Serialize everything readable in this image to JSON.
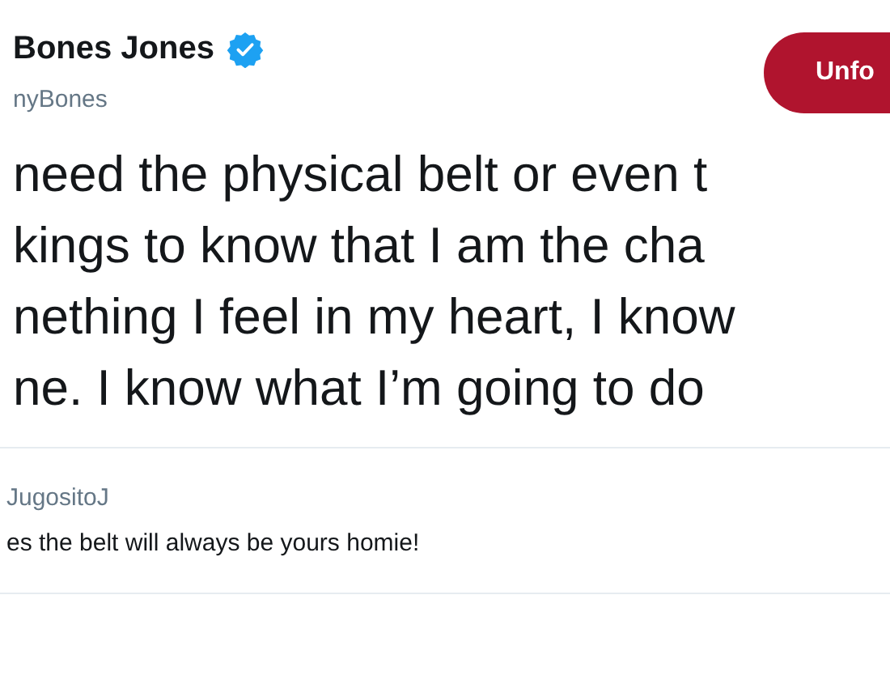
{
  "author": {
    "name": "Bones Jones",
    "verified": true,
    "handle": "nyBones"
  },
  "follow_button": {
    "label": "Unfo"
  },
  "tweet_lines": [
    "need the physical belt or even t",
    "kings to know that I am the cha",
    "nething I feel in my heart, I know",
    "ne. I know what I’m going to do"
  ],
  "reply": {
    "handle": "JugositoJ",
    "text": "es the belt will always be yours homie!"
  }
}
